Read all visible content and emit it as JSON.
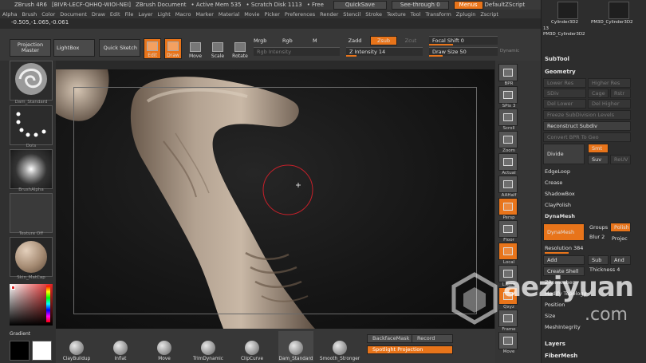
{
  "titlebar": {
    "app": "ZBrush 4R6",
    "serial": "[BIVR-LECF-QHHQ-WIOI-NEI]",
    "doc": "ZBrush Document",
    "active_mem": "• Active Mem 535",
    "scratch": "• Scratch Disk 1113",
    "free": "• Free",
    "quicksave": "QuickSave",
    "seethrough": "See-through 0",
    "menus": "Menus",
    "script": "DefaultZScript"
  },
  "menubar": [
    "Alpha",
    "Brush",
    "Color",
    "Document",
    "Draw",
    "Edit",
    "File",
    "Layer",
    "Light",
    "Macro",
    "Marker",
    "Material",
    "Movie",
    "Picker",
    "Preferences",
    "Render",
    "Stencil",
    "Stroke",
    "Texture",
    "Tool",
    "Transform",
    "Zplugin",
    "Zscript"
  ],
  "coords": "-0.505,-1.065,-0.061",
  "topshelf": {
    "projection_master": "Projection Master",
    "lightbox": "LightBox",
    "quick_sketch": "Quick Sketch",
    "edit": "Edit",
    "draw": "Draw",
    "move": "Move",
    "scale": "Scale",
    "rotate": "Rotate",
    "mrgb": "Mrgb",
    "rgb": "Rgb",
    "m": "M",
    "rgb_intensity": "Rgb Intensity",
    "zadd": "Zadd",
    "zsub": "Zsub",
    "zcut": "Zcut",
    "z_intensity": "Z Intensity 14",
    "focal_shift": "Focal Shift 0",
    "draw_size": "Draw Size 50",
    "dynamic": "Dynamic"
  },
  "z_intensity_value": 14,
  "draw_size_value": 50,
  "lefttray": {
    "brush": "Dam_Standard",
    "stroke": "Dots",
    "alpha": "BrushAlpha",
    "texture": "Texture Off",
    "material": "Skin_MatCap",
    "gradient": "Gradient"
  },
  "rightcol": {
    "bpr": "BPR",
    "spix": "SPix 3",
    "scroll": "Scroll",
    "zoom": "Zoom",
    "actual": "Actual",
    "aahalf": "AAHalf",
    "persp": "Persp",
    "floor": "Floor",
    "local": "Local",
    "lsym": "L.Sym",
    "xyz": "Qxyz",
    "frame": "Frame",
    "move": "Move"
  },
  "righttray": {
    "thumb1": "Cylinder3D2",
    "thumb2": "PM3D_Cylinder3D2",
    "thumb_count": "13",
    "thumb3": "PM3D_Cylinder3D2",
    "subtool": "SubTool",
    "geometry": "Geometry",
    "lower_res": "Lower Res",
    "higher_res": "Higher Res",
    "sdiv": "SDiv",
    "cage": "Cage",
    "rstr": "Rstr",
    "del_lower": "Del Lower",
    "del_higher": "Del Higher",
    "freeze": "Freeze SubDivision Levels",
    "reconstruct": "Reconstruct Subdiv",
    "convert": "Convert BPR To Geo",
    "divide": "Divide",
    "smt": "Smt",
    "suv": "Suv",
    "reuv": "ReUV",
    "edgeloop": "EdgeLoop",
    "crease": "Crease",
    "shadowbox": "ShadowBox",
    "claypolish": "ClayPolish",
    "dynamesh_head": "DynaMesh",
    "dynamesh_btn": "DynaMesh",
    "groups": "Groups",
    "polish": "Polish",
    "blur": "Blur 2",
    "project": "Projec",
    "resolution": "Resolution 384",
    "add": "Add",
    "sub": "Sub",
    "and": "And",
    "create_shell": "Create Shell",
    "thickness": "Thickness 4",
    "zremesher": "ZRemesher",
    "modify_topology": "Modify Topology",
    "position": "Position",
    "size": "Size",
    "meshintegrity": "MeshIntegrity",
    "layers": "Layers",
    "fibermesh": "FiberMesh"
  },
  "bottom": {
    "brushes": [
      "ClayBuildup",
      "Inflat",
      "Move",
      "TrimDynamic",
      "ClipCurve",
      "Dam_Standard",
      "Smooth_Stronger"
    ],
    "backface": "BackfaceMask",
    "record": "Record",
    "spotlight": "Spotlight Projection"
  },
  "watermark": {
    "brand": "aeziyuan",
    "domain": ".com"
  },
  "colors": {
    "accent": "#e8741a",
    "panel": "#2d2d2d",
    "brush_red": "#c8202a"
  }
}
